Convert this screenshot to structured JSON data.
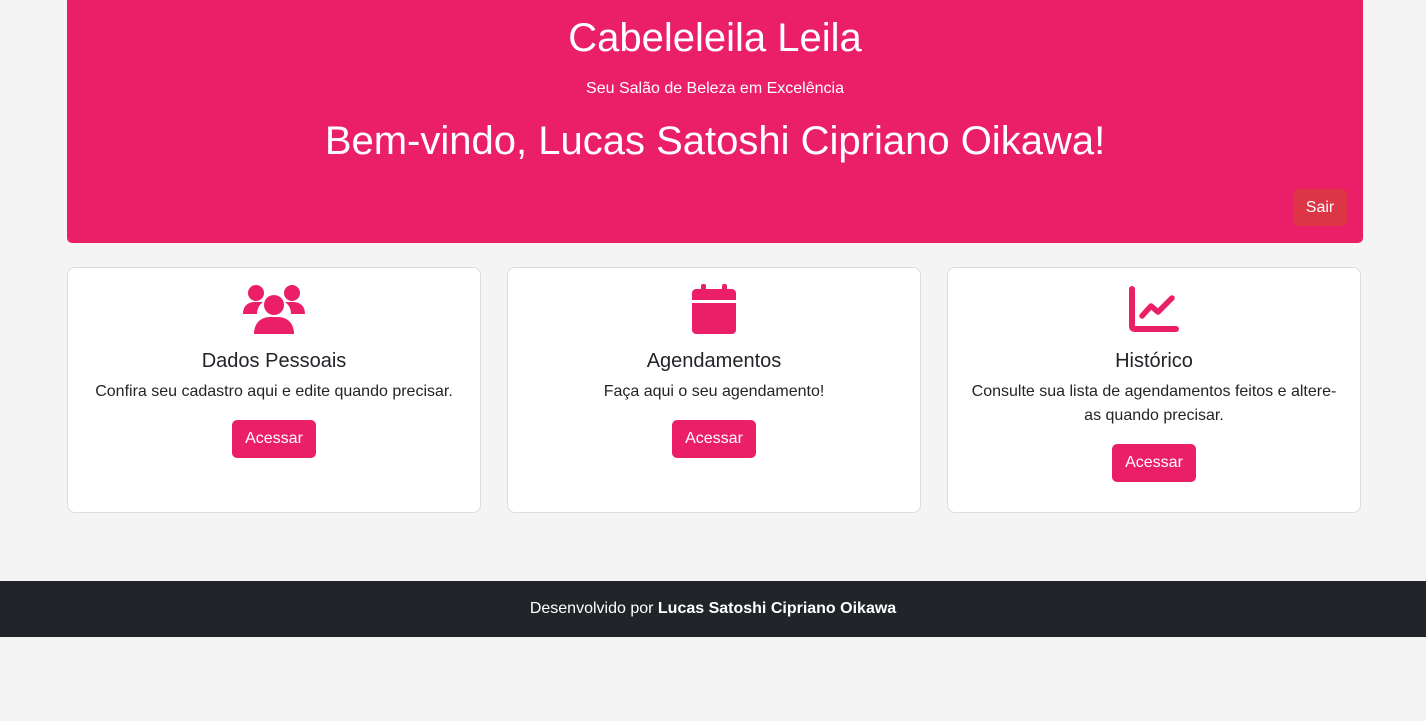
{
  "header": {
    "brand": "Cabeleleila Leila",
    "tagline": "Seu Salão de Beleza em Excelência",
    "welcome": "Bem-vindo, Lucas Satoshi Cipriano Oikawa!",
    "logout_label": "Sair"
  },
  "cards": [
    {
      "icon": "users-icon",
      "title": "Dados Pessoais",
      "description": "Confira seu cadastro aqui e edite quando precisar.",
      "button_label": "Acessar"
    },
    {
      "icon": "calendar-icon",
      "title": "Agendamentos",
      "description": "Faça aqui o seu agendamento!",
      "button_label": "Acessar"
    },
    {
      "icon": "chart-line-icon",
      "title": "Histórico",
      "description": "Consulte sua lista de agendamentos feitos e altere-as quando precisar.",
      "button_label": "Acessar"
    }
  ],
  "footer": {
    "prefix": "Desenvolvido por",
    "author": "Lucas Satoshi Cipriano Oikawa"
  },
  "colors": {
    "primary": "#eb1f67",
    "danger": "#dc3545",
    "footer_bg": "#212529",
    "page_bg": "#f4f4f4"
  }
}
